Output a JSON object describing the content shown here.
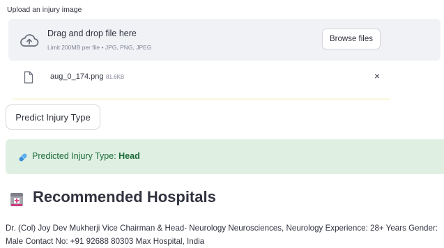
{
  "uploader": {
    "label": "Upload an injury image",
    "title": "Drag and drop file here",
    "subtitle": "Limit 200MB per file • JPG, PNG, JPEG",
    "browse_label": "Browse files"
  },
  "file": {
    "name": "aug_0_174.png",
    "size": "81.6KB",
    "close_symbol": "×",
    "icon": "file-icon"
  },
  "predict_button": {
    "label": "Predict Injury Type"
  },
  "result": {
    "prefix": "Predicted Injury Type: ",
    "value": "Head",
    "icon": "pill-icon",
    "bg_color": "#dff0e3",
    "text_color": "#1c6b38"
  },
  "hospitals": {
    "heading": "Recommended Hospitals",
    "icon": "hospital-icon",
    "entry": "Dr. (Col) Joy Dev Mukherji Vice Chairman & Head- Neurology Neurosciences, Neurology Experience: 28+ Years Gender: Male Contact No: +91 92688 80303 Max Hospital, India"
  }
}
